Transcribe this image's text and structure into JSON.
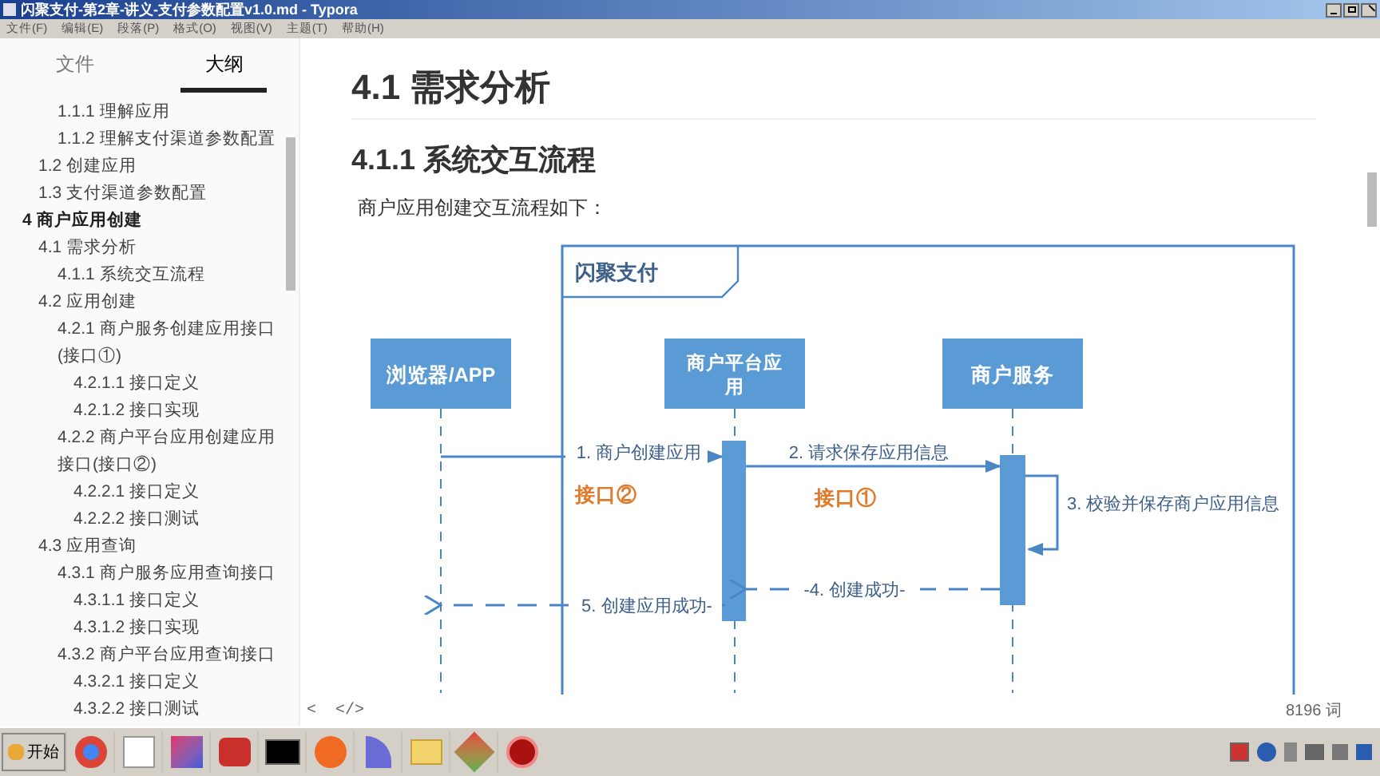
{
  "window": {
    "title": "闪聚支付-第2章-讲义-支付参数配置v1.0.md - Typora"
  },
  "menu": [
    "文件(F)",
    "编辑(E)",
    "段落(P)",
    "格式(O)",
    "视图(V)",
    "主题(T)",
    "帮助(H)"
  ],
  "sidebar": {
    "tabs": [
      {
        "label": "文件",
        "selected": false
      },
      {
        "label": "大纲",
        "selected": true
      }
    ],
    "outline": [
      {
        "children": [
          {
            "children": [
              {
                "label": "1.1.1 理解应用"
              },
              {
                "label": "1.1.2 理解支付渠道参数配置"
              }
            ]
          },
          {
            "label": "1.2 创建应用"
          },
          {
            "label": "1.3 支付渠道参数配置"
          }
        ]
      },
      {
        "label": "4 商户应用创建",
        "children": [
          {
            "label": "4.1 需求分析",
            "children": [
              {
                "label": "4.1.1 系统交互流程"
              }
            ]
          },
          {
            "label": "4.2 应用创建",
            "children": [
              {
                "label": "4.2.1 商户服务创建应用接口(接口①)",
                "children": [
                  {
                    "label": "4.2.1.1 接口定义"
                  },
                  {
                    "label": "4.2.1.2 接口实现"
                  }
                ]
              },
              {
                "label": "4.2.2 商户平台应用创建应用接口(接口②)",
                "children": [
                  {
                    "label": "4.2.2.1 接口定义"
                  },
                  {
                    "label": "4.2.2.2 接口测试"
                  }
                ]
              }
            ]
          },
          {
            "label": "4.3 应用查询",
            "children": [
              {
                "label": "4.3.1 商户服务应用查询接口",
                "children": [
                  {
                    "label": "4.3.1.1 接口定义"
                  },
                  {
                    "label": "4.3.1.2 接口实现"
                  }
                ]
              },
              {
                "label": "4.3.2 商户平台应用查询接口",
                "children": [
                  {
                    "label": "4.3.2.1 接口定义"
                  },
                  {
                    "label": "4.3.2.2 接口测试"
                  }
                ]
              }
            ]
          }
        ]
      }
    ]
  },
  "document": {
    "h1": "4.1 需求分析",
    "h2": "4.1.1 系统交互流程",
    "paragraph": "商户应用创建交互流程如下：",
    "diagram": {
      "frame_label": "闪聚支付",
      "participants": [
        "浏览器/APP",
        "商户平台应用",
        "商户服务"
      ],
      "messages": [
        {
          "kind": "call",
          "label": "1. 商户创建应用"
        },
        {
          "kind": "call",
          "label": "2. 请求保存应用信息"
        },
        {
          "kind": "self",
          "label": "3. 校验并保存商户应用信息"
        },
        {
          "kind": "return",
          "label": "-4. 创建成功-"
        },
        {
          "kind": "return",
          "label": "5. 创建应用成功-"
        }
      ],
      "notes": [
        "接口②",
        "接口①"
      ]
    }
  },
  "footer": {
    "back": "<",
    "source": "</>",
    "word_count": "8196 词"
  },
  "taskbar": {
    "start": "开始"
  }
}
